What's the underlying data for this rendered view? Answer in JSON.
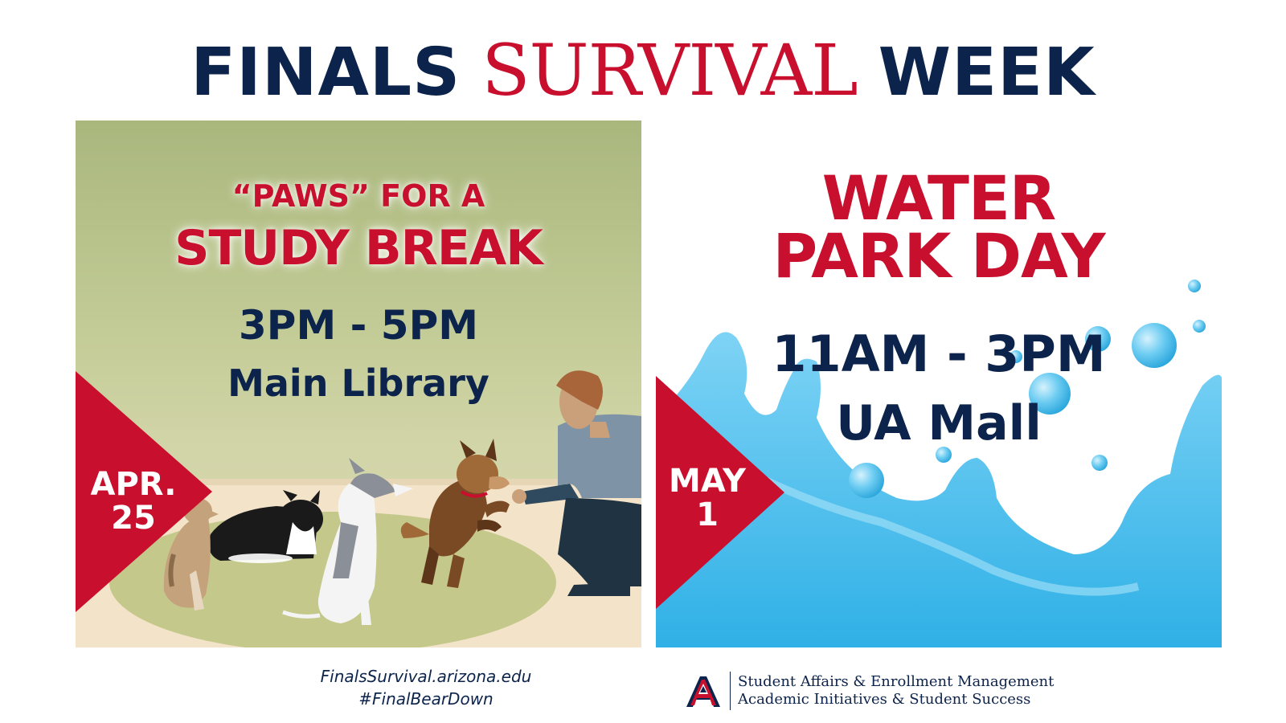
{
  "headline": {
    "word1": "FINALS",
    "word2": "SURVIVAL",
    "word3": "WEEK"
  },
  "event_left": {
    "line1": "“PAWS” FOR A",
    "line2": "STUDY BREAK",
    "time": "3PM - 5PM",
    "location": "Main Library",
    "date_month": "APR.",
    "date_day": "25"
  },
  "event_right": {
    "line1": "WATER",
    "line2": "PARK DAY",
    "time": "11AM - 3PM",
    "location": "UA Mall",
    "date_month": "MAY",
    "date_day": "1"
  },
  "footer": {
    "website": "FinalsSurvival.arizona.edu",
    "hashtag": "#FinalBearDown",
    "org_line1": "Student Affairs & Enrollment Management",
    "org_line2": "Academic Initiatives & Student Success"
  },
  "colors": {
    "navy": "#0c234b",
    "red": "#c8102e",
    "water": "#4fc3ee"
  }
}
